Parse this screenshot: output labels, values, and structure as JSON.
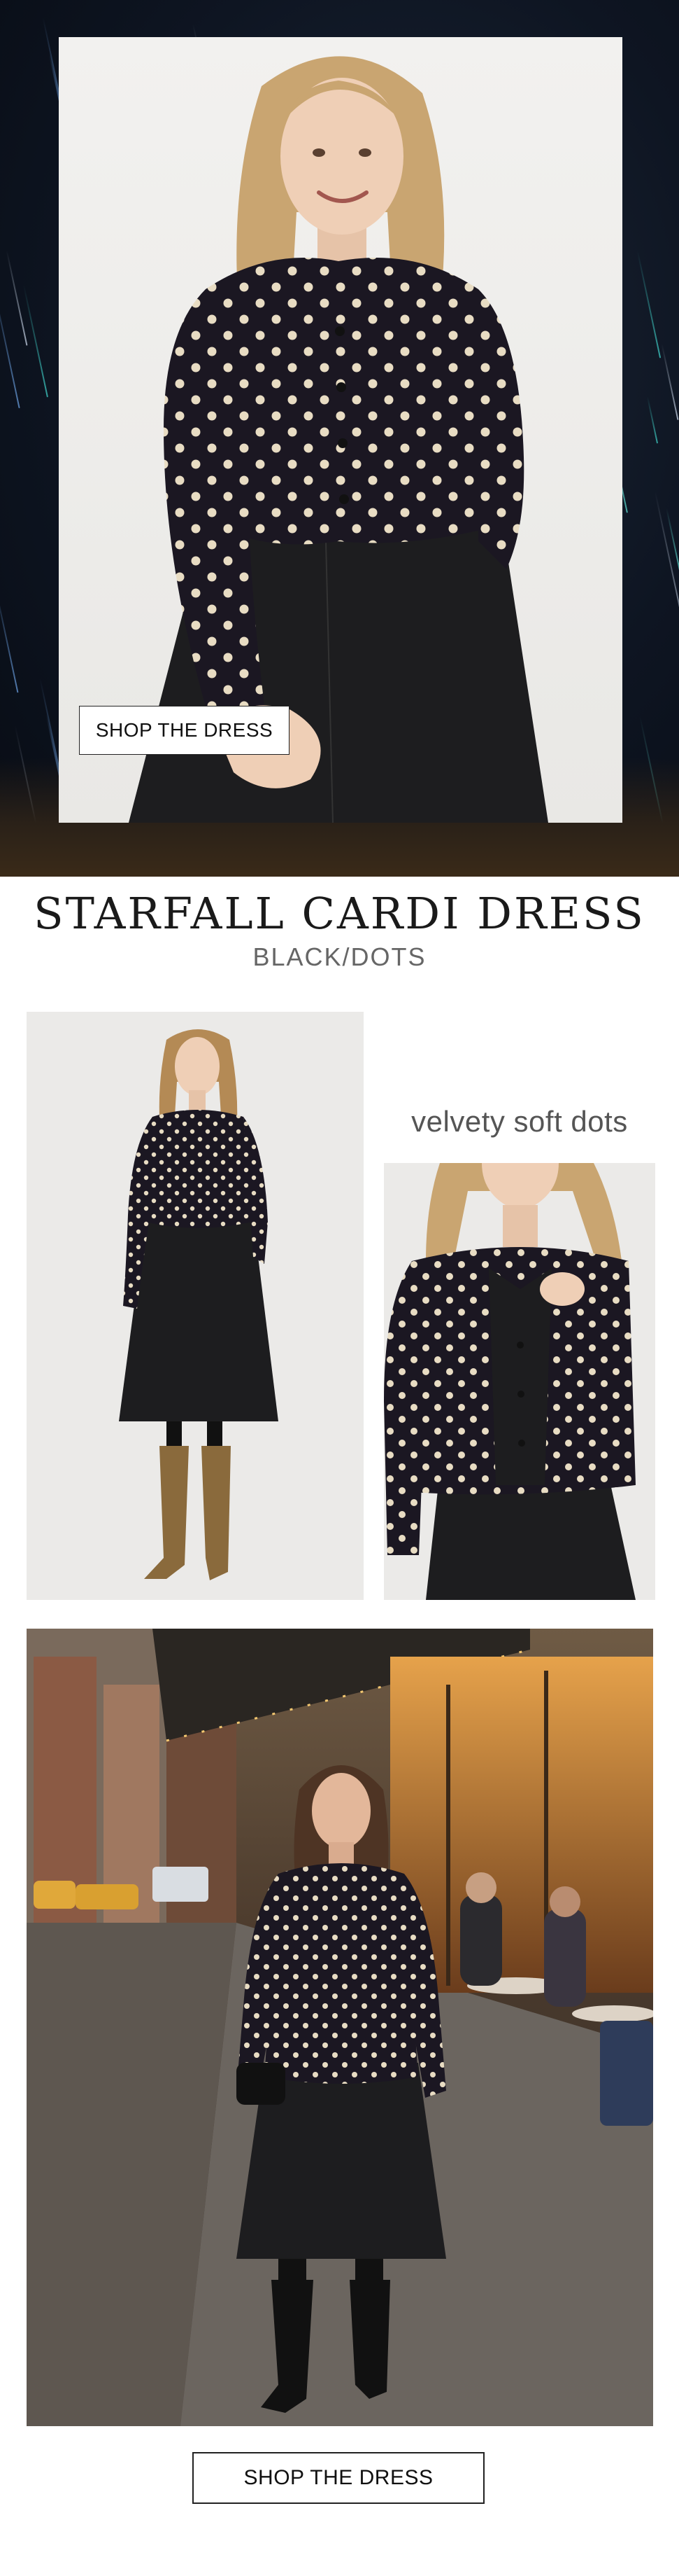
{
  "hero": {
    "cta_label": "SHOP THE DRESS",
    "background": "starfall night sky",
    "photo": "model in polka dot velvet cardigan over black dress"
  },
  "product": {
    "title": "STARFALL CARDI DRESS",
    "color": "BLACK/DOTS"
  },
  "feature": {
    "tagline": "velvety soft dots"
  },
  "footer": {
    "cta_label": "SHOP THE DRESS"
  },
  "colors": {
    "night_sky": "#0e1522",
    "cardigan": "#1b1722",
    "dot": "#e8dcc3",
    "dress": "#1d1d1f",
    "studio_bg": "#ebeae8",
    "boots": "#8a6a3c"
  }
}
